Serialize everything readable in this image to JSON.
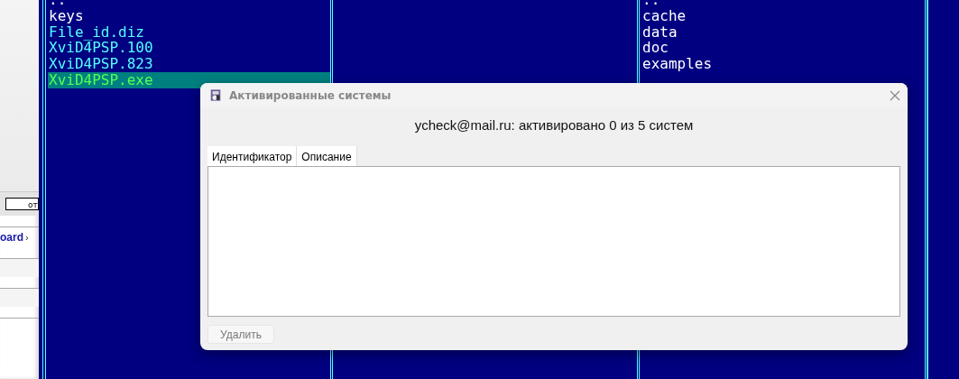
{
  "browser_strip": {
    "field_text": "от",
    "link": "oard",
    "link_arrow": "›"
  },
  "panels": [
    {
      "files": [
        {
          "name": "..",
          "kind": "dir",
          "selected": false
        },
        {
          "name": "keys",
          "kind": "dir",
          "selected": false
        },
        {
          "name": "File_id.diz",
          "kind": "file",
          "selected": false
        },
        {
          "name": "XviD4PSP.100",
          "kind": "file",
          "selected": false
        },
        {
          "name": "XviD4PSP.823",
          "kind": "file",
          "selected": false
        },
        {
          "name": "XviD4PSP.exe",
          "kind": "exe",
          "selected": true
        }
      ]
    },
    {
      "files": [
        {
          "name": "..",
          "kind": "dir",
          "selected": false
        },
        {
          "name": "cache",
          "kind": "dir",
          "selected": false
        },
        {
          "name": "data",
          "kind": "dir",
          "selected": false
        },
        {
          "name": "doc",
          "kind": "dir",
          "selected": false
        },
        {
          "name": "examples",
          "kind": "dir",
          "selected": false
        }
      ]
    }
  ],
  "dialog": {
    "title": "Активированные системы",
    "summary": "ycheck@mail.ru: активировано 0 из 5 систем",
    "columns": [
      "Идентификатор",
      "Описание"
    ],
    "buttons": [
      {
        "label": "Удалить",
        "disabled": true
      }
    ]
  }
}
